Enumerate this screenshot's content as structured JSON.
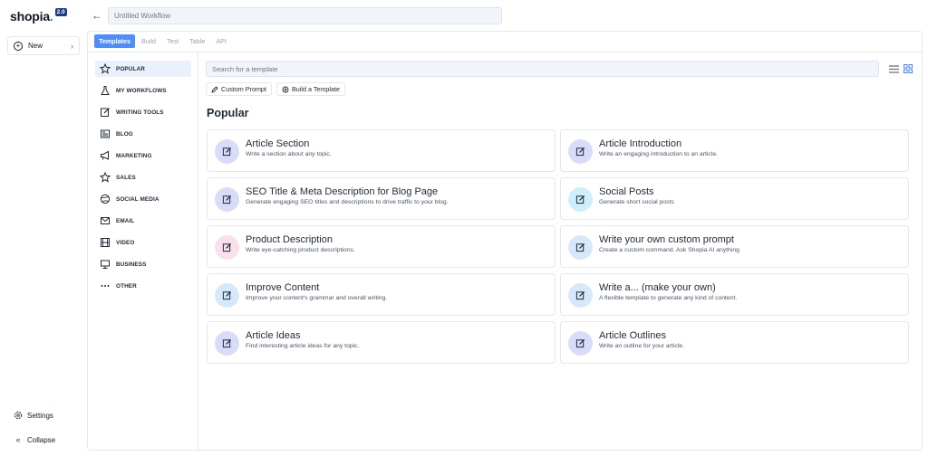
{
  "app": {
    "logo_text": "shopia",
    "logo_dot": ".",
    "version_badge": "2.0",
    "new_button": "New",
    "settings_label": "Settings",
    "collapse_label": "Collapse"
  },
  "workflow": {
    "name_placeholder": "Untitled Workflow"
  },
  "tabs": [
    {
      "label": "Templates",
      "active": true
    },
    {
      "label": "Build",
      "active": false
    },
    {
      "label": "Test",
      "active": false
    },
    {
      "label": "Table",
      "active": false
    },
    {
      "label": "API",
      "active": false
    }
  ],
  "categories": [
    {
      "label": "POPULAR",
      "icon": "star-icon",
      "active": true
    },
    {
      "label": "MY WORKFLOWS",
      "icon": "flask-icon",
      "active": false
    },
    {
      "label": "WRITING TOOLS",
      "icon": "edit-icon",
      "active": false
    },
    {
      "label": "BLOG",
      "icon": "newspaper-icon",
      "active": false
    },
    {
      "label": "MARKETING",
      "icon": "megaphone-icon",
      "active": false
    },
    {
      "label": "SALES",
      "icon": "star-icon",
      "active": false
    },
    {
      "label": "SOCIAL MEDIA",
      "icon": "globe-icon",
      "active": false
    },
    {
      "label": "EMAIL",
      "icon": "mail-icon",
      "active": false
    },
    {
      "label": "VIDEO",
      "icon": "film-icon",
      "active": false
    },
    {
      "label": "BUSINESS",
      "icon": "monitor-icon",
      "active": false
    },
    {
      "label": "OTHER",
      "icon": "more-icon",
      "active": false
    }
  ],
  "search": {
    "placeholder": "Search for a template"
  },
  "chips": {
    "custom_prompt": "Custom Prompt",
    "build_template": "Build a Template"
  },
  "section_title": "Popular",
  "templates": [
    {
      "title": "Article Section",
      "description": "Write a section about any topic.",
      "icon": "edit-icon",
      "color": "#d9dcf8"
    },
    {
      "title": "Article Introduction",
      "description": "Write an engaging introduction to an article.",
      "icon": "edit-icon",
      "color": "#d9dcf8"
    },
    {
      "title": "SEO Title & Meta Description for Blog Page",
      "description": "Generate engaging SEO titles and descriptions to drive traffic to your blog.",
      "icon": "edit-icon",
      "color": "#d9dcf8"
    },
    {
      "title": "Social Posts",
      "description": "Generate short social posts",
      "icon": "edit-icon",
      "color": "#cfeefb"
    },
    {
      "title": "Product Description",
      "description": "Write eye-catching product descriptions.",
      "icon": "edit-icon",
      "color": "#fbe0ec"
    },
    {
      "title": "Write your own custom prompt",
      "description": "Create a custom command. Ask Shopia AI anything",
      "icon": "edit-icon",
      "color": "#d6e9fb"
    },
    {
      "title": "Improve Content",
      "description": "Improve your content's grammar and overall writing.",
      "icon": "edit-icon",
      "color": "#d6e9fb"
    },
    {
      "title": "Write a... (make your own)",
      "description": "A flexible template to generate any kind of content.",
      "icon": "edit-icon",
      "color": "#d6e9fb"
    },
    {
      "title": "Article Ideas",
      "description": "Find interesting article ideas for any topic.",
      "icon": "edit-icon",
      "color": "#d9dcf8"
    },
    {
      "title": "Article Outlines",
      "description": "Write an outline for your article.",
      "icon": "edit-icon",
      "color": "#d9dcf8"
    }
  ]
}
